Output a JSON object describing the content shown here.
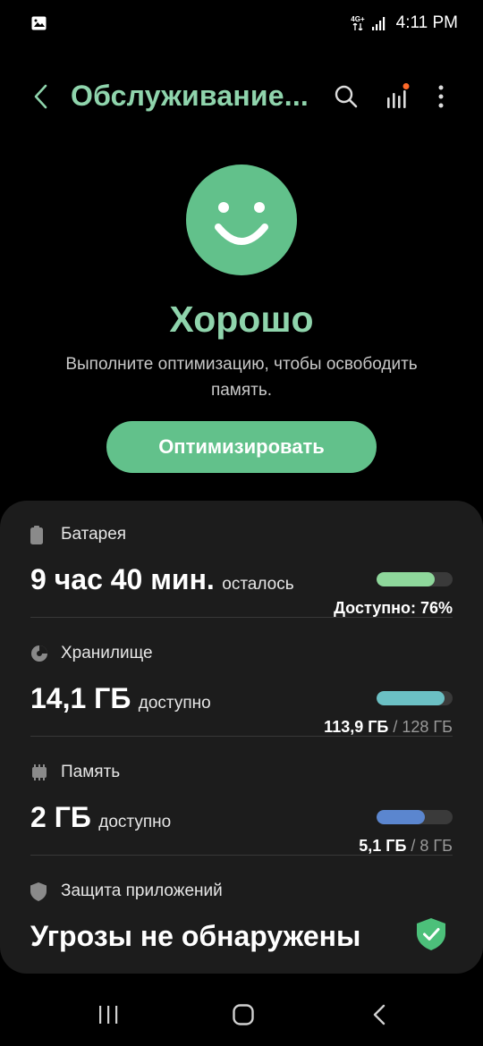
{
  "status_bar": {
    "time": "4:11 PM",
    "network_type": "4G+",
    "icons": [
      "gallery-icon",
      "data-arrows-icon",
      "signal-icon"
    ]
  },
  "app_bar": {
    "title": "Обслуживание...",
    "icons": [
      "back-arrow-icon",
      "search-icon",
      "stats-icon",
      "more-vert-icon"
    ],
    "notification_dot_color": "#ff6a2a"
  },
  "hero": {
    "status_title": "Хорошо",
    "description": "Выполните оптимизацию, чтобы освободить память.",
    "optimize_label": "Оптимизировать"
  },
  "colors": {
    "accent": "#62c18b",
    "accent_text": "#8fd4ac",
    "card_bg": "#1c1c1c",
    "battery_bar": "#8ed79b",
    "storage_bar": "#6bc0c4",
    "memory_bar": "#5b86cf"
  },
  "sections": {
    "battery": {
      "label": "Батарея",
      "value_big": "9 час 40 мин.",
      "value_small": "осталось",
      "right_bold": "Доступно: 76%",
      "level": 0.76,
      "icon": "battery-icon"
    },
    "storage": {
      "label": "Хранилище",
      "value_big": "14,1 ГБ",
      "value_small": "доступно",
      "right_used": "113,9 ГБ",
      "right_total": "/ 128 ГБ",
      "level": 0.89,
      "icon": "storage-pie-icon"
    },
    "memory": {
      "label": "Память",
      "value_big": "2 ГБ",
      "value_small": "доступно",
      "right_used": "5,1 ГБ",
      "right_total": "/ 8 ГБ",
      "level": 0.64,
      "icon": "memory-chip-icon"
    },
    "protection": {
      "label": "Защита приложений",
      "value": "Угрозы не обнаружены",
      "icon": "shield-icon",
      "status_icon": "shield-check-icon"
    }
  },
  "nav_bar": {
    "icons": [
      "recents-icon",
      "home-icon",
      "back-icon"
    ]
  }
}
